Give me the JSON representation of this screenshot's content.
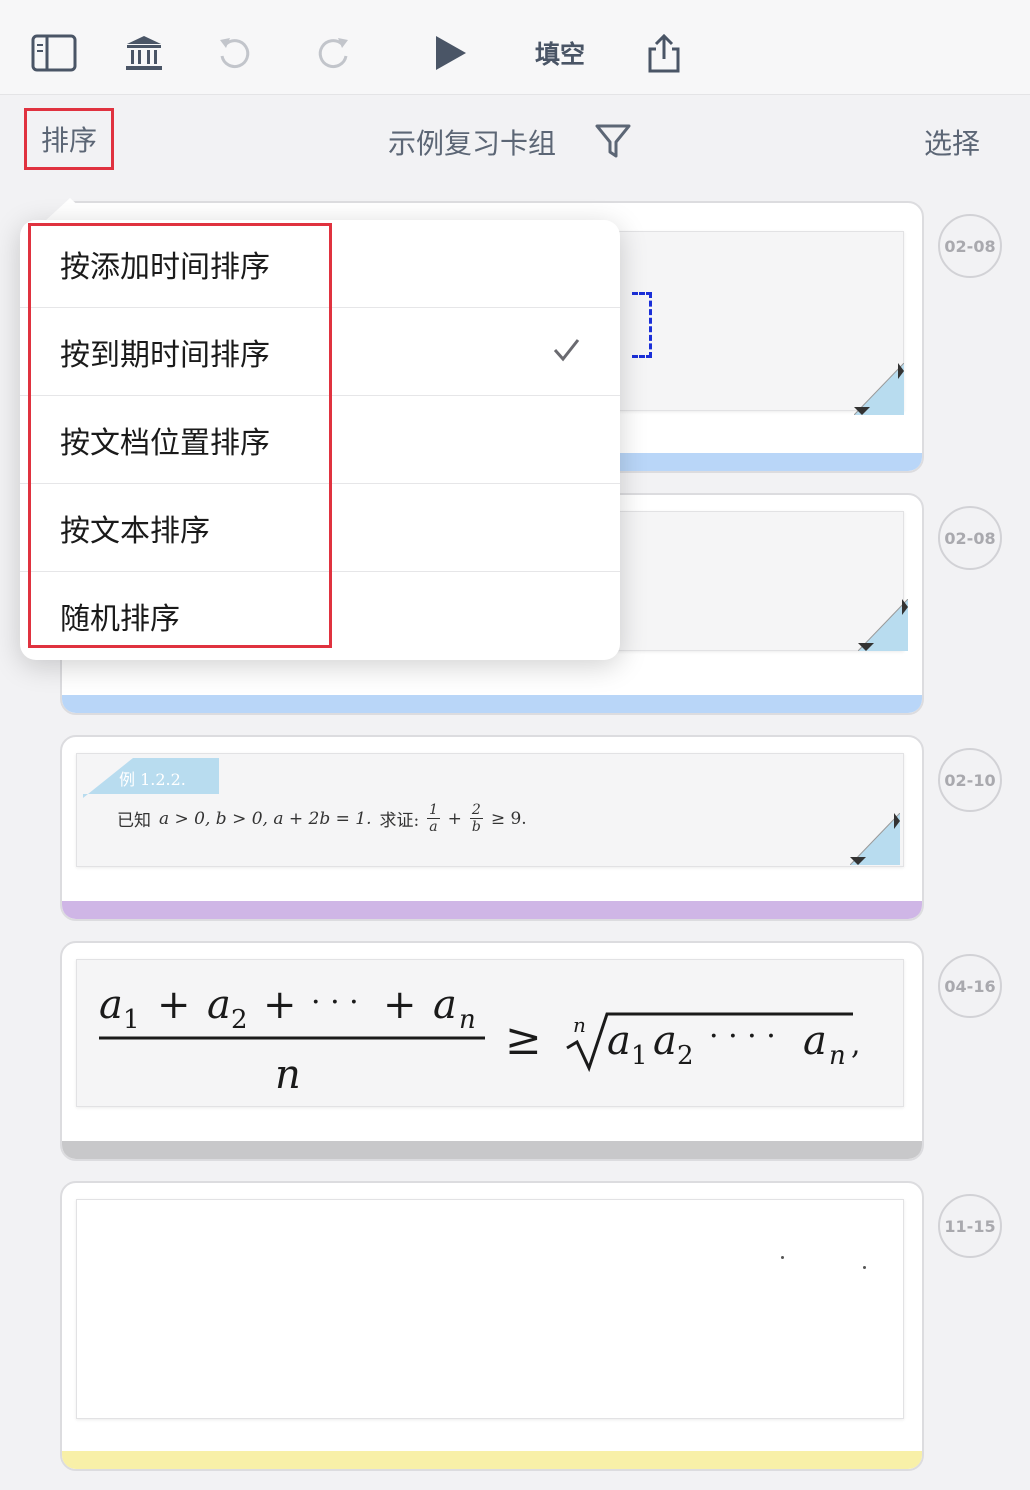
{
  "toolbar": {
    "icons": [
      "sidebar-icon",
      "library-icon",
      "undo-icon",
      "redo-icon",
      "play-icon",
      "share-icon"
    ],
    "mode_label": "填空"
  },
  "header": {
    "sort_label": "排序",
    "deck_title": "示例复习卡组",
    "select_label": "选择"
  },
  "sort_menu": {
    "items": [
      {
        "label": "按添加时间排序",
        "checked": false
      },
      {
        "label": "按到期时间排序",
        "checked": true
      },
      {
        "label": "按文档位置排序",
        "checked": false
      },
      {
        "label": "按文本排序",
        "checked": false
      },
      {
        "label": "随机排序",
        "checked": false
      }
    ]
  },
  "cards": [
    {
      "date": "02-08",
      "bar_color": "#b9d6f8"
    },
    {
      "date": "02-08",
      "bar_color": "#b9d6f8"
    },
    {
      "date": "02-10",
      "bar_color": "#cfb6e6",
      "example_tag": "例 1.2.2.",
      "text_prefix": "已知",
      "text_condition": "a > 0, b > 0, a + 2b = 1.",
      "text_prove": "求证:",
      "text_tail": "≥ 9."
    },
    {
      "date": "04-16",
      "bar_color": "#c8c8ca"
    },
    {
      "date": "11-15",
      "bar_color": "#f8f0a8"
    }
  ],
  "colors": {
    "highlight": "#e0323f",
    "corner_blue": "#b8dcef"
  }
}
